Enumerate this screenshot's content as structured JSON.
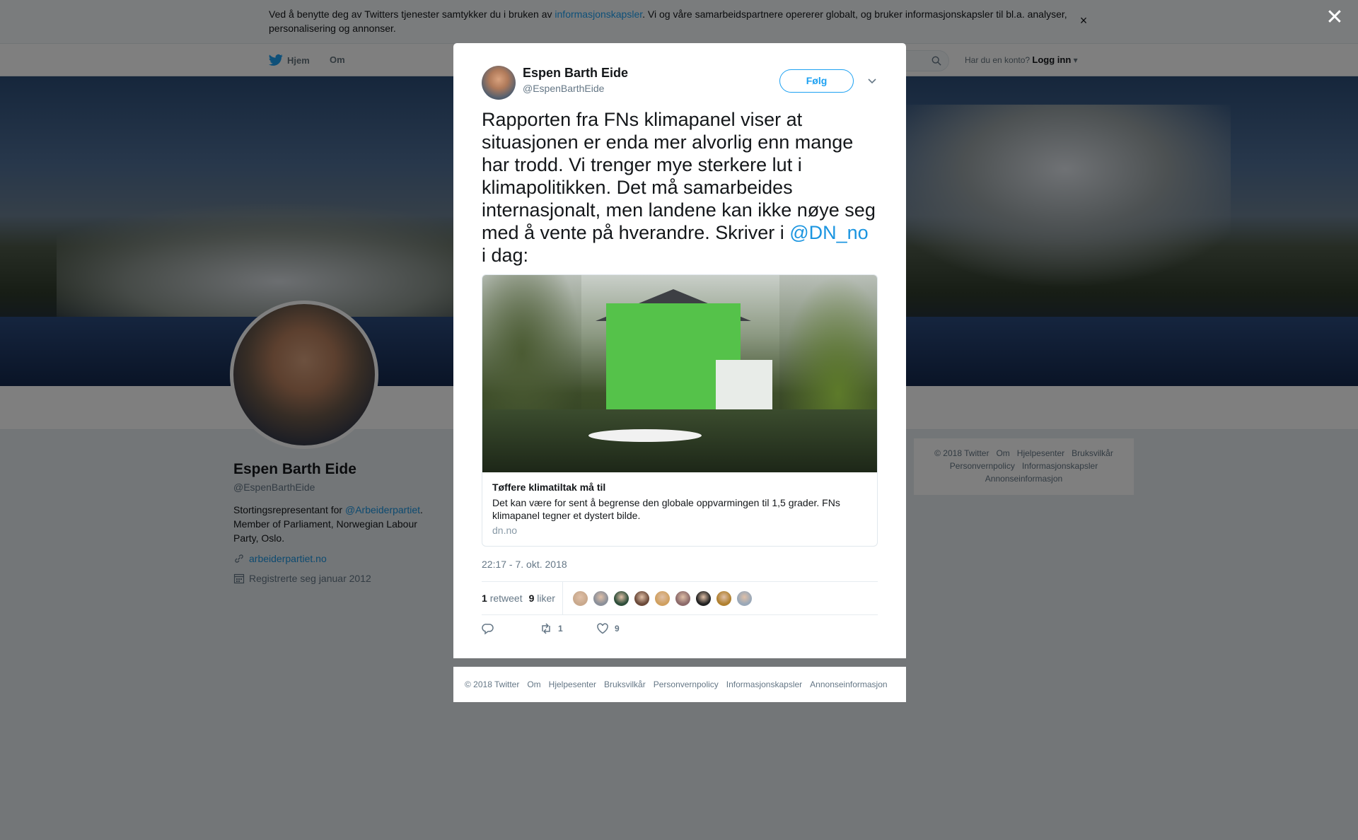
{
  "cookie_bar": {
    "text_before": "Ved å benytte deg av Twitters tjenester samtykker du i bruken av ",
    "link": "informasjonskapsler",
    "text_after": ". Vi og våre samarbeidspartnere opererer globalt, og bruker informasjonskapsler til bl.a. analyser, personalisering og annonser.",
    "close": "×"
  },
  "nav": {
    "home": "Hjem",
    "about": "Om",
    "login_prompt": "Har du en konto?",
    "login": "Logg inn"
  },
  "profile": {
    "name": "Espen Barth Eide",
    "handle": "@EspenBarthEide",
    "bio_before": "Stortingsrepresentant for ",
    "bio_mention": "@Arbeiderpartiet",
    "bio_after": ". Member of Parliament, Norwegian Labour Party, Oslo.",
    "url": "arbeiderpartiet.no",
    "joined": "Registrerte seg januar 2012"
  },
  "side_footer": {
    "items": [
      "© 2018 Twitter",
      "Om",
      "Hjelpesenter",
      "Bruksvilkår",
      "Personvernpolicy",
      "Informasjonskapsler",
      "Annonseinformasjon"
    ]
  },
  "modal": {
    "close": "✕",
    "author_name": "Espen Barth Eide",
    "author_handle": "@EspenBarthEide",
    "follow": "Følg",
    "tweet_text": "Rapporten fra FNs klimapanel viser at situasjonen er enda mer alvorlig enn mange har trodd. Vi trenger mye sterkere lut i klimapolitikken. Det må samarbeides internasjonalt, men landene kan ikke nøye seg med å vente på hverandre. Skriver i ",
    "tweet_mention": "@DN_no",
    "tweet_end": " i dag:",
    "card": {
      "title": "Tøffere klimatiltak må til",
      "description": "Det kan være for sent å begrense den globale oppvarmingen til 1,5 grader. FNs klimapanel tegner et dystert bilde.",
      "domain": "dn.no"
    },
    "timestamp": "22:17 - 7. okt. 2018",
    "retweets_count": "1",
    "retweets_label": "retweet",
    "likes_count": "9",
    "likes_label": "liker",
    "likers_colors": [
      "#c9a98d",
      "#8a8f99",
      "#2e4e3a",
      "#6b4a3a",
      "#d0a060",
      "#8c6a6a",
      "#222222",
      "#b08030",
      "#9aa8b8"
    ],
    "action_retweet_count": "1",
    "action_like_count": "9"
  },
  "modal_footer": {
    "items": [
      "© 2018 Twitter",
      "Om",
      "Hjelpesenter",
      "Bruksvilkår",
      "Personvernpolicy",
      "Informasjonskapsler",
      "Annonseinformasjon"
    ]
  },
  "colors": {
    "accent": "#1da1f2",
    "link": "#1b95e0",
    "muted": "#657786"
  }
}
